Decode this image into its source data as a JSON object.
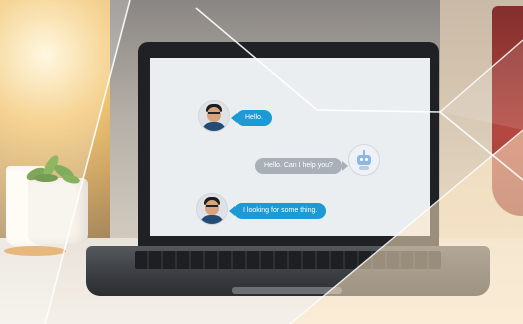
{
  "chat": {
    "messages": [
      {
        "sender": "user",
        "text": "Hello."
      },
      {
        "sender": "bot",
        "text": "Hello. Can I help you?"
      },
      {
        "sender": "user",
        "text": "I looking for some thing."
      }
    ]
  },
  "colors": {
    "user_bubble": "#1c9ad6",
    "bot_bubble": "#a9b0b8",
    "frame": "#fbf3e6"
  },
  "icons": [
    "user-avatar-icon",
    "robot-avatar-icon"
  ]
}
